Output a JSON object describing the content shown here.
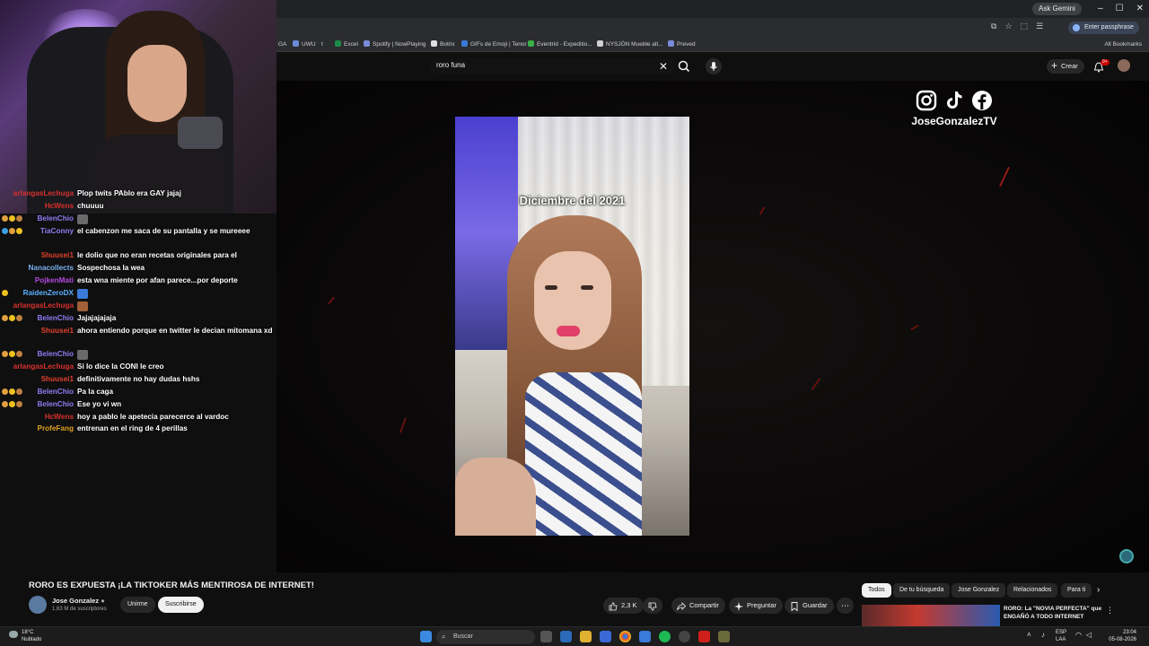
{
  "browser": {
    "gemini_label": "Ask Gemini",
    "passphrase_label": "Enter passphrase",
    "window_buttons": [
      "–",
      "☐",
      "✕"
    ],
    "bookmarks": [
      "GA",
      "UWU",
      "t",
      "Excel",
      "Spotify | NowPlaying",
      "Botrix",
      "GIFs de Emoji | Tenor",
      "Eventrid - Expeditio...",
      "NYSJÓN Mueble alt...",
      "Preved"
    ],
    "all_bookmarks": "All Bookmarks"
  },
  "youtube": {
    "search_query": "roro funa",
    "create_label": "Crear",
    "notif_count": "9+"
  },
  "video": {
    "caption": "Diciembre del 2021",
    "social_tag": "JoseGonzalezTV"
  },
  "chat": [
    {
      "user": "arlangasLechuga",
      "color": "#d8312c",
      "text": "Plop twits PAblo era GAY jajaj",
      "badges": []
    },
    {
      "user": "HcWens",
      "color": "#d8312c",
      "text": "chuuuu",
      "badges": []
    },
    {
      "user": "BelenChio",
      "color": "#8d7cf2",
      "text": "",
      "emote": "#6a6a6a",
      "badges": [
        "#e0a040",
        "#f0c020",
        "#c08040"
      ]
    },
    {
      "user": "TiaConny",
      "color": "#8d7cf2",
      "text": "el cabenzon me saca de su pantalla y se mureeee",
      "badges": [
        "#3aa0e0",
        "#e0a040",
        "#f0c020"
      ]
    },
    {
      "user": "Shuusei1",
      "color": "#e0402c",
      "text": "le dolio que no eran recetas originales para el",
      "badges": []
    },
    {
      "user": "Nanacollects",
      "color": "#7ab0f0",
      "text": "Sospechosa la wea",
      "badges": []
    },
    {
      "user": "PojkenMati",
      "color": "#b04ae0",
      "text": "esta wna miente por afan parece...por deporte",
      "badges": []
    },
    {
      "user": "RaidenZeroDX",
      "color": "#5ab0ff",
      "text": "",
      "emote": "#3a7ad8",
      "badges": [
        "#f0c020"
      ]
    },
    {
      "user": "arlangasLechuga",
      "color": "#d8312c",
      "text": "",
      "emote": "#a0603a",
      "badges": []
    },
    {
      "user": "BelenChio",
      "color": "#8d7cf2",
      "text": "Jajajajajaja",
      "badges": [
        "#e0a040",
        "#f0c020",
        "#c08040"
      ]
    },
    {
      "user": "Shuusei1",
      "color": "#e0402c",
      "text": "ahora entiendo porque en twitter le decian mitomana xd",
      "badges": []
    },
    {
      "user": "BelenChio",
      "color": "#8d7cf2",
      "text": "",
      "emote": "#6a6a6a",
      "badges": [
        "#e0a040",
        "#f0c020",
        "#c08040"
      ]
    },
    {
      "user": "arlangasLechuga",
      "color": "#d8312c",
      "text": "Si lo dice la CONI le creo",
      "badges": []
    },
    {
      "user": "Shuusei1",
      "color": "#e0402c",
      "text": "definitivamente no hay dudas hshs",
      "badges": []
    },
    {
      "user": "BelenChio",
      "color": "#8d7cf2",
      "text": "Pa la caga",
      "badges": [
        "#e0a040",
        "#f0c020",
        "#c08040"
      ]
    },
    {
      "user": "BelenChio",
      "color": "#8d7cf2",
      "text": "Ese yo vi wn",
      "badges": [
        "#e0a040",
        "#f0c020",
        "#c08040"
      ]
    },
    {
      "user": "HcWens",
      "color": "#d8312c",
      "text": "hoy a pablo le apetecia parecerce al vardoc",
      "badges": []
    },
    {
      "user": "ProfeFang",
      "color": "#e0a020",
      "text": "entrenan en el ring de 4 perillas",
      "badges": []
    }
  ],
  "watch": {
    "title": "RORO ES EXPUESTA ¡LA TIKTOKER MÁS MENTIROSA DE INTERNET!",
    "channel": "Jose Gonzalez",
    "subs": "1,63 M de suscriptores",
    "join": "Unirme",
    "subscribe": "Suscribirse",
    "likes": "2,3 K",
    "share": "Compartir",
    "ask": "Preguntar",
    "save": "Guardar"
  },
  "chips": [
    "Todos",
    "De tu búsqueda",
    "Jose Gonzalez",
    "Relacionados",
    "Para ti"
  ],
  "related": {
    "title": "RORO: La \"NOVIA PERFECTA\" que ENGAÑÓ A TODO INTERNET"
  },
  "taskbar": {
    "temp": "18°C",
    "weather": "Nublado",
    "search": "Buscar",
    "lang1": "ESP",
    "lang2": "LAA",
    "time": "23:04",
    "date": "05-08-2026"
  }
}
